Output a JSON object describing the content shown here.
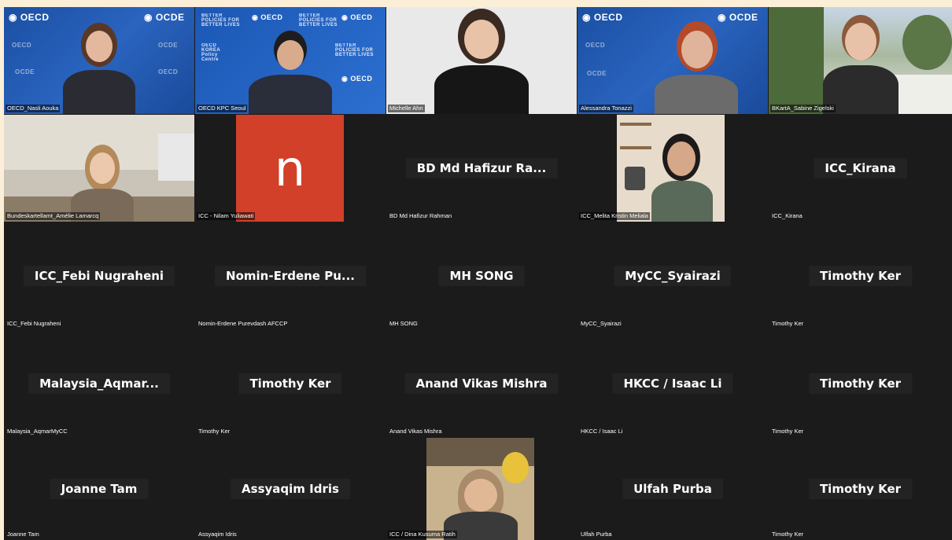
{
  "participants": [
    {
      "tag": "OECD_Nasli Aouka"
    },
    {
      "tag": "OECD KPC Seoul"
    },
    {
      "tag": "Michelle Ahn"
    },
    {
      "tag": "Alessandra Tonazzi"
    },
    {
      "tag": "BKartA_Sabine Zigelski"
    },
    {
      "tag": "Bundeskartellamt_Amélie Lamarcq"
    },
    {
      "tag": "ICC - Nilam Yuliawati",
      "initial": "n"
    },
    {
      "tag": "BD Md Hafizur Rahman",
      "display": "BD Md Hafizur Ra..."
    },
    {
      "tag": "ICC_Melita Kristin Meliala"
    },
    {
      "tag": "ICC_Kirana",
      "display": "ICC_Kirana"
    },
    {
      "tag": "ICC_Febi Nugraheni",
      "display": "ICC_Febi Nugraheni"
    },
    {
      "tag": "Nomin-Erdene Purevdash AFCCP",
      "display": "Nomin-Erdene Pu..."
    },
    {
      "tag": "MH SONG",
      "display": "MH SONG"
    },
    {
      "tag": "MyCC_Syairazi",
      "display": "MyCC_Syairazi"
    },
    {
      "tag": "Timothy Ker",
      "display": "Timothy Ker"
    },
    {
      "tag": "Malaysia_AqmarMyCC",
      "display": "Malaysia_Aqmar..."
    },
    {
      "tag": "Timothy Ker",
      "display": "Timothy Ker"
    },
    {
      "tag": "Anand Vikas Mishra",
      "display": "Anand Vikas Mishra"
    },
    {
      "tag": "HKCC / Isaac Li",
      "display": "HKCC / Isaac Li"
    },
    {
      "tag": "Timothy Ker",
      "display": "Timothy Ker"
    },
    {
      "tag": "Joanne Tam",
      "display": "Joanne Tam"
    },
    {
      "tag": "Assyaqim Idris",
      "display": "Assyaqim Idris"
    },
    {
      "tag": "ICC / Dina Kusuma Ratih"
    },
    {
      "tag": "Ulfah Purba",
      "display": "Ulfah Purba"
    },
    {
      "tag": "Timothy Ker",
      "display": "Timothy Ker"
    }
  ],
  "backgrounds": {
    "oecd_logo": "OECD",
    "ocde_logo": "OCDE",
    "better_policies": "BETTER POLICIES FOR BETTER LIVES",
    "oecd_korea": "OECD KOREA Policy Centre"
  },
  "colors": {
    "page_bg": "#fcefd8",
    "grid_bg": "#1a1a1a",
    "tile_bg": "#1b1b1b",
    "name_box": "#232323",
    "oecd_blue": "#1b4fa3",
    "avatar_orange": "#d2402a"
  }
}
